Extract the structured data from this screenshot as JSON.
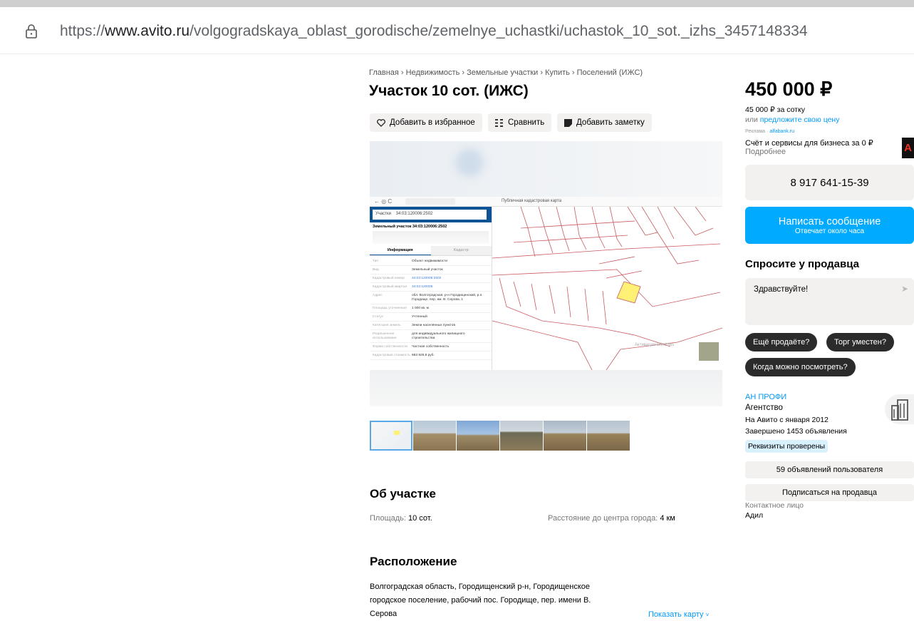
{
  "browser": {
    "url_prefix": "https://",
    "url_domain": "www.avito.ru",
    "url_path": "/volgogradskaya_oblast_gorodische/zemelnye_uchastki/uchastok_10_sot._izhs_3457148334"
  },
  "breadcrumbs": "Главная › Недвижимость › Земельные участки › Купить › Поселений (ИЖС)",
  "title": "Участок 10 сот. (ИЖС)",
  "actions": {
    "favorite": "Добавить в избранное",
    "compare": "Сравнить",
    "note": "Добавить заметку"
  },
  "gallery": {
    "map_window_title": "Публичная кадастровая карта",
    "search_label": "Участки",
    "search_value": "34:03:120006:2502",
    "parcel_title": "Земельный участок 34:03:120006:2502",
    "tab_info": "Информация",
    "tab_rights": "Кадастр",
    "rows": [
      {
        "k": "Тип",
        "v": "Объект недвижимости"
      },
      {
        "k": "Вид",
        "v": "Земельный участок"
      },
      {
        "k": "Кадастровый номер",
        "v": "34:03:120006:2502"
      },
      {
        "k": "Кадастровый квартал",
        "v": "34:03:120006"
      },
      {
        "k": "Адрес",
        "v": "обл. Волгоградская, р-н Городищенский, р.п. Городище, пер. им. В. Серова, 1"
      },
      {
        "k": "Площадь уточненная",
        "v": "1 000 кв. м"
      },
      {
        "k": "Статус",
        "v": "Учтенный"
      },
      {
        "k": "Категория земель",
        "v": "Земли населённых пунктов"
      },
      {
        "k": "Разрешенное использование",
        "v": "для индивидуального жилищного строительства"
      },
      {
        "k": "Форма собственности",
        "v": "Частная собственность"
      },
      {
        "k": "Кадастровая стоимость",
        "v": "683 925,8 руб."
      }
    ],
    "watermark": "Активация Windows"
  },
  "about": {
    "heading": "Об участке",
    "area_label": "Площадь:",
    "area_value": "10 сот.",
    "distance_label": "Расстояние до центра города:",
    "distance_value": "4 км"
  },
  "location": {
    "heading": "Расположение",
    "line1": "Волгоградская область, Городищенский р-н, Городищенское",
    "line2": "городское поселение, рабочий пос. Городище, пер. имени В.",
    "line3": "Серова",
    "show_map": "Показать карту"
  },
  "sidebar": {
    "price": "450 000 ₽",
    "per_sotka": "45 000 ₽ за сотку",
    "offer_prefix": "или",
    "offer_link": "предложите свою цену",
    "ad_label": "Реклама",
    "ad_domain": "alfabank.ru",
    "ad_text": "Счёт и сервисы для бизнеса за 0 ₽",
    "ad_more": "Подробнее",
    "ad_logo": "A",
    "phone": "8 917 641-15-39",
    "message_btn": "Написать сообщение",
    "message_sub": "Отвечает около часа",
    "ask_heading": "Спросите у продавца",
    "ask_placeholder": "Здравствуйте!",
    "chips": [
      "Ещё продаёте?",
      "Торг уместен?",
      "Когда можно посмотреть?"
    ],
    "seller_name": "АН ПРОФИ",
    "seller_type": "Агентство",
    "seller_since": "На Авито с января 2012",
    "seller_done": "Завершено 1453 объявления",
    "verified": "Реквизиты проверены",
    "user_ads": "59 объявлений пользователя",
    "subscribe": "Подписаться на продавца",
    "contact_label": "Контактное лицо",
    "contact_name": "Адил"
  },
  "colors": {
    "accent": "#00aaff",
    "link": "#0099f7",
    "highlight_parcel": "#fff176",
    "parcel_lines": "#c9595f"
  }
}
